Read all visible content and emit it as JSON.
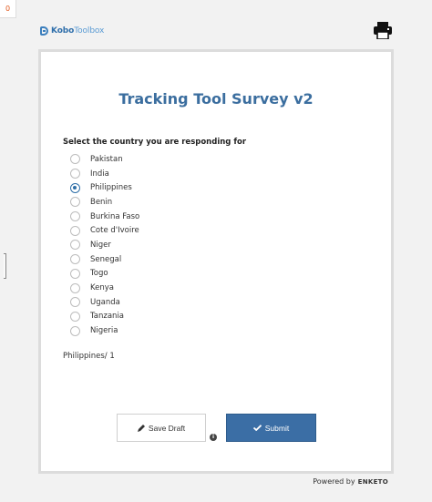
{
  "app": {
    "corner_badge": "0",
    "logo_strong": "Kobo",
    "logo_light": "Toolbox",
    "print_icon": "printer-icon"
  },
  "form": {
    "title": "Tracking Tool Survey v2",
    "question": "Select the country you are responding for",
    "options": [
      {
        "label": "Pakistan",
        "checked": false
      },
      {
        "label": "India",
        "checked": false
      },
      {
        "label": "Philippines",
        "checked": true
      },
      {
        "label": "Benin",
        "checked": false
      },
      {
        "label": "Burkina Faso",
        "checked": false
      },
      {
        "label": "Cote d'Ivoire",
        "checked": false
      },
      {
        "label": "Niger",
        "checked": false
      },
      {
        "label": "Senegal",
        "checked": false
      },
      {
        "label": "Togo",
        "checked": false
      },
      {
        "label": "Kenya",
        "checked": false
      },
      {
        "label": "Uganda",
        "checked": false
      },
      {
        "label": "Tanzania",
        "checked": false
      },
      {
        "label": "Nigeria",
        "checked": false
      }
    ],
    "calculated_value": "Philippines/ 1"
  },
  "actions": {
    "save_draft": "Save Draft",
    "submit": "Submit",
    "info_symbol": "i"
  },
  "footer": {
    "powered_by": "Powered by",
    "brand": "ENKETO"
  },
  "colors": {
    "accent": "#3b6ea5",
    "title": "#3b6e9f"
  }
}
